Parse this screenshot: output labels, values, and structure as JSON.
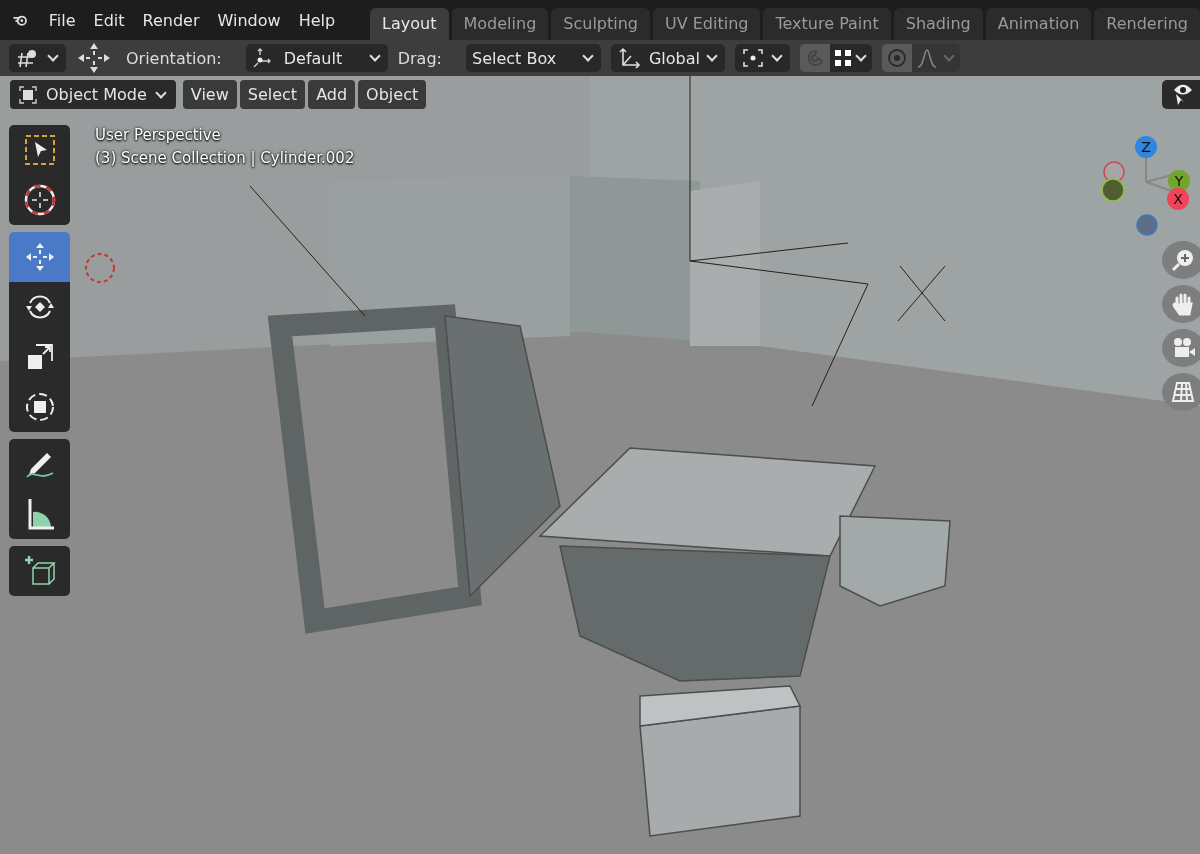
{
  "menu": [
    "File",
    "Edit",
    "Render",
    "Window",
    "Help"
  ],
  "workspaces": [
    {
      "label": "Layout",
      "selected": true
    },
    {
      "label": "Modeling",
      "selected": false
    },
    {
      "label": "Sculpting",
      "selected": false
    },
    {
      "label": "UV Editing",
      "selected": false
    },
    {
      "label": "Texture Paint",
      "selected": false
    },
    {
      "label": "Shading",
      "selected": false
    },
    {
      "label": "Animation",
      "selected": false
    },
    {
      "label": "Rendering",
      "selected": false
    }
  ],
  "tool_header": {
    "orientation_label": "Orientation:",
    "orientation": "Default",
    "drag_label": "Drag:",
    "drag": "Select Box",
    "transform_orientation": "Global"
  },
  "viewport_header": {
    "mode": "Object Mode",
    "menus": [
      "View",
      "Select",
      "Add",
      "Object"
    ]
  },
  "viewport_info": [
    "User Perspective",
    "(3) Scene Collection | Cylinder.002"
  ],
  "toolbar": [
    {
      "tools": [
        {
          "kind": "select",
          "selected": false
        },
        {
          "kind": "cursor",
          "selected": false
        }
      ]
    },
    {
      "tools": [
        {
          "kind": "move",
          "selected": true
        },
        {
          "kind": "rotate",
          "selected": false
        },
        {
          "kind": "scale",
          "selected": false
        },
        {
          "kind": "transform",
          "selected": false
        }
      ]
    },
    {
      "tools": [
        {
          "kind": "annotate",
          "selected": false
        },
        {
          "kind": "measure",
          "selected": false
        }
      ]
    },
    {
      "tools": [
        {
          "kind": "add",
          "selected": false
        }
      ]
    }
  ],
  "gizmo": {
    "z": "Z",
    "y": "Y",
    "x": "X"
  }
}
